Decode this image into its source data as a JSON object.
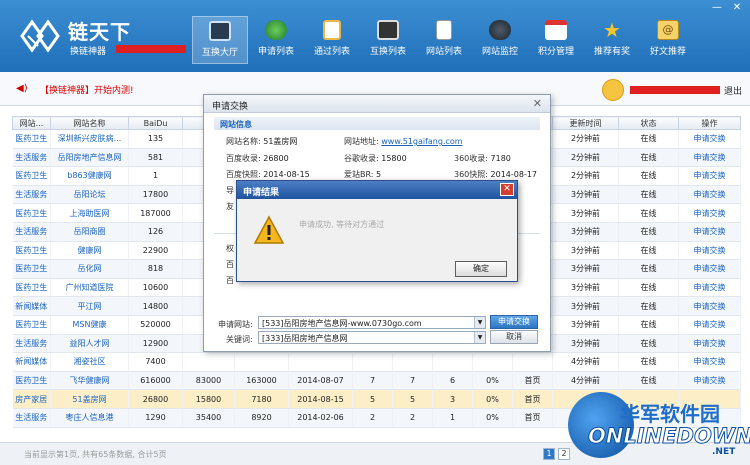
{
  "app": {
    "logo_title": "链天下",
    "logo_sub": "换链神器"
  },
  "nav": [
    {
      "label": "互换大厅",
      "icon": "monitor-icon"
    },
    {
      "label": "申请列表",
      "icon": "globe-icon"
    },
    {
      "label": "通过列表",
      "icon": "clipboard-icon"
    },
    {
      "label": "互换列表",
      "icon": "screen-icon"
    },
    {
      "label": "网站列表",
      "icon": "file-icon"
    },
    {
      "label": "网站监控",
      "icon": "monitor-eye-icon"
    },
    {
      "label": "积分管理",
      "icon": "calendar-icon"
    },
    {
      "label": "推荐有奖",
      "icon": "star-icon"
    },
    {
      "label": "好文推荐",
      "icon": "mail-icon"
    }
  ],
  "window": {
    "minimize": "—",
    "close": "✕"
  },
  "notice": {
    "text": "【换链神器】开始内测!"
  },
  "user": {
    "logout": "退出"
  },
  "table": {
    "headers": [
      "网站...",
      "网站名称",
      "BaiDu",
      "",
      "",
      "",
      "",
      "",
      "",
      "",
      "",
      "更新时间",
      "状态",
      "操作"
    ],
    "rows": [
      [
        "医药卫生",
        "深圳新兴皮肤病...",
        "135",
        "",
        "",
        "",
        "",
        "",
        "",
        "",
        "",
        "2分钟前",
        "在线",
        "申请交换"
      ],
      [
        "生活服务",
        "岳阳房地产信息网",
        "581",
        "",
        "",
        "",
        "",
        "",
        "",
        "",
        "",
        "2分钟前",
        "在线",
        "申请交换"
      ],
      [
        "医药卫生",
        "b863健康网",
        "1",
        "",
        "",
        "",
        "",
        "",
        "",
        "",
        "",
        "2分钟前",
        "在线",
        "申请交换"
      ],
      [
        "生活服务",
        "岳阳论坛",
        "17800",
        "",
        "",
        "",
        "",
        "",
        "",
        "",
        "",
        "3分钟前",
        "在线",
        "申请交换"
      ],
      [
        "医药卫生",
        "上海助医网",
        "187000",
        "",
        "",
        "",
        "",
        "",
        "",
        "",
        "",
        "3分钟前",
        "在线",
        "申请交换"
      ],
      [
        "生活服务",
        "岳阳商圈",
        "126",
        "",
        "",
        "",
        "",
        "",
        "",
        "",
        "",
        "3分钟前",
        "在线",
        "申请交换"
      ],
      [
        "医药卫生",
        "健康网",
        "22900",
        "",
        "",
        "",
        "",
        "",
        "",
        "",
        "",
        "3分钟前",
        "在线",
        "申请交换"
      ],
      [
        "医药卫生",
        "岳化网",
        "818",
        "",
        "",
        "",
        "",
        "",
        "",
        "",
        "",
        "3分钟前",
        "在线",
        "申请交换"
      ],
      [
        "医药卫生",
        "广州知道医院",
        "10600",
        "",
        "",
        "",
        "",
        "",
        "",
        "",
        "",
        "3分钟前",
        "在线",
        "申请交换"
      ],
      [
        "新闻媒体",
        "平江网",
        "14800",
        "",
        "",
        "",
        "",
        "",
        "",
        "",
        "",
        "3分钟前",
        "在线",
        "申请交换"
      ],
      [
        "医药卫生",
        "MSN健康",
        "520000",
        "",
        "",
        "",
        "",
        "",
        "",
        "",
        "",
        "3分钟前",
        "在线",
        "申请交换"
      ],
      [
        "生活服务",
        "益阳人才网",
        "12900",
        "",
        "",
        "",
        "",
        "",
        "",
        "",
        "",
        "3分钟前",
        "在线",
        "申请交换"
      ],
      [
        "新闻媒体",
        "湘姿社区",
        "7400",
        "",
        "",
        "",
        "",
        "",
        "",
        "",
        "",
        "4分钟前",
        "在线",
        "申请交换"
      ],
      [
        "医药卫生",
        "飞华健康网",
        "616000",
        "83000",
        "163000",
        "2014-08-07",
        "7",
        "7",
        "6",
        "0%",
        "首页",
        "4分钟前",
        "在线",
        "申请交换"
      ],
      [
        "房产家居",
        "51盖房网",
        "26800",
        "15800",
        "7180",
        "2014-08-15",
        "5",
        "5",
        "3",
        "0%",
        "首页",
        "",
        "",
        ""
      ],
      [
        "生活服务",
        "枣庄人信息港",
        "1290",
        "35400",
        "8920",
        "2014-02-06",
        "2",
        "2",
        "1",
        "0%",
        "首页",
        "",
        "",
        ""
      ]
    ]
  },
  "footer": {
    "text": "当前显示第1页, 共有65条数据, 合计5页",
    "pages": [
      "1",
      "2"
    ]
  },
  "exchange_dialog": {
    "title": "申请交换",
    "close": "✕",
    "section": "网站信息",
    "site_name_label": "网站名称:",
    "site_name": "51盖房网",
    "site_url_label": "网站地址:",
    "site_url": "www.51gaifang.com",
    "baidu_count_label": "百度收录:",
    "baidu_count": "26800",
    "google_count_label": "谷歌收录:",
    "google_count": "15800",
    "s360_count_label": "360收录:",
    "s360_count": "7180",
    "baidu_snapshot_label": "百度快照:",
    "baidu_snapshot": "2014-08-15",
    "aizhan_br_label": "爱站BR:",
    "aizhan_br": "5",
    "s360_snapshot_label": "360快照:",
    "s360_snapshot": "2014-08-17",
    "row4_partial": "导",
    "row5_partial": "友",
    "row6_partial": "权",
    "row7_partial": "百",
    "row8_partial": "百",
    "my_site_label": "申请网站:",
    "my_site": "[533]岳阳房地产信息网-www.0730go.com",
    "keyword_label": "关键词:",
    "keyword": "[333]岳阳房地产信息网",
    "apply_button": "申请交换",
    "cancel_button": "取消"
  },
  "result_modal": {
    "title": "申请结果",
    "close": "✕",
    "message": "申请成功, 等待对方通过",
    "ok": "确定"
  },
  "watermark": {
    "cn": "华军软件园",
    "en": "ONLINEDOWN",
    "com": ".NET"
  },
  "colors": {
    "header_blue": "#1f6fb9",
    "link_blue": "#1a63c2",
    "notice_red": "#dd0000",
    "highlight_row": "#fcefc7"
  }
}
